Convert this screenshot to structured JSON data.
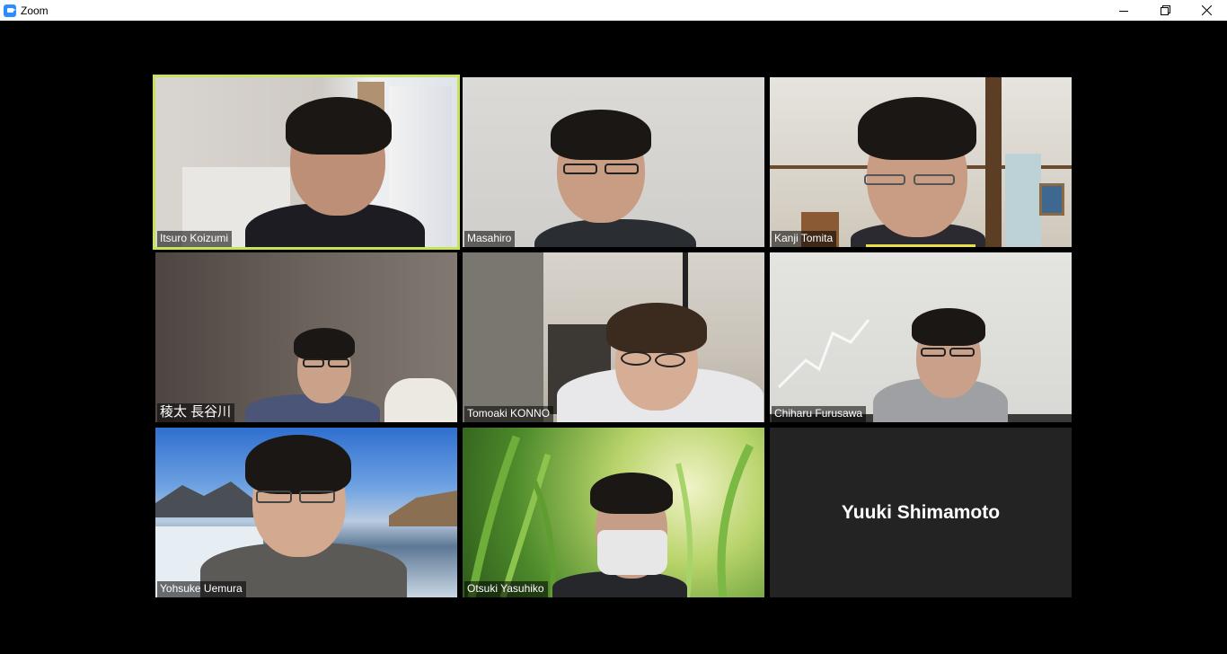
{
  "window": {
    "title": "Zoom",
    "icon": "zoom-camera-icon",
    "controls": [
      "minimize-icon",
      "restore-icon",
      "close-icon"
    ]
  },
  "participants": [
    {
      "name": "Itsuro Koizumi",
      "active_speaker": true,
      "video": true
    },
    {
      "name": "Masahiro",
      "video": true
    },
    {
      "name": "Kanji Tomita",
      "video": true,
      "audio_level_bar": true
    },
    {
      "name": "稜太 長谷川",
      "video": true
    },
    {
      "name": "Tomoaki KONNO",
      "video": true
    },
    {
      "name": "Chiharu Furusawa",
      "video": true
    },
    {
      "name": "Yohsuke Uemura",
      "video": true
    },
    {
      "name": "Otsuki Yasuhiko",
      "video": true
    },
    {
      "name": "Yuuki Shimamoto",
      "video": false
    }
  ],
  "colors": {
    "active_speaker_border": "#c6e25e",
    "titlebar_bg": "#ffffff",
    "stage_bg": "#000000",
    "no_video_tile": "#232323",
    "zoom_blue": "#2d8cff"
  }
}
